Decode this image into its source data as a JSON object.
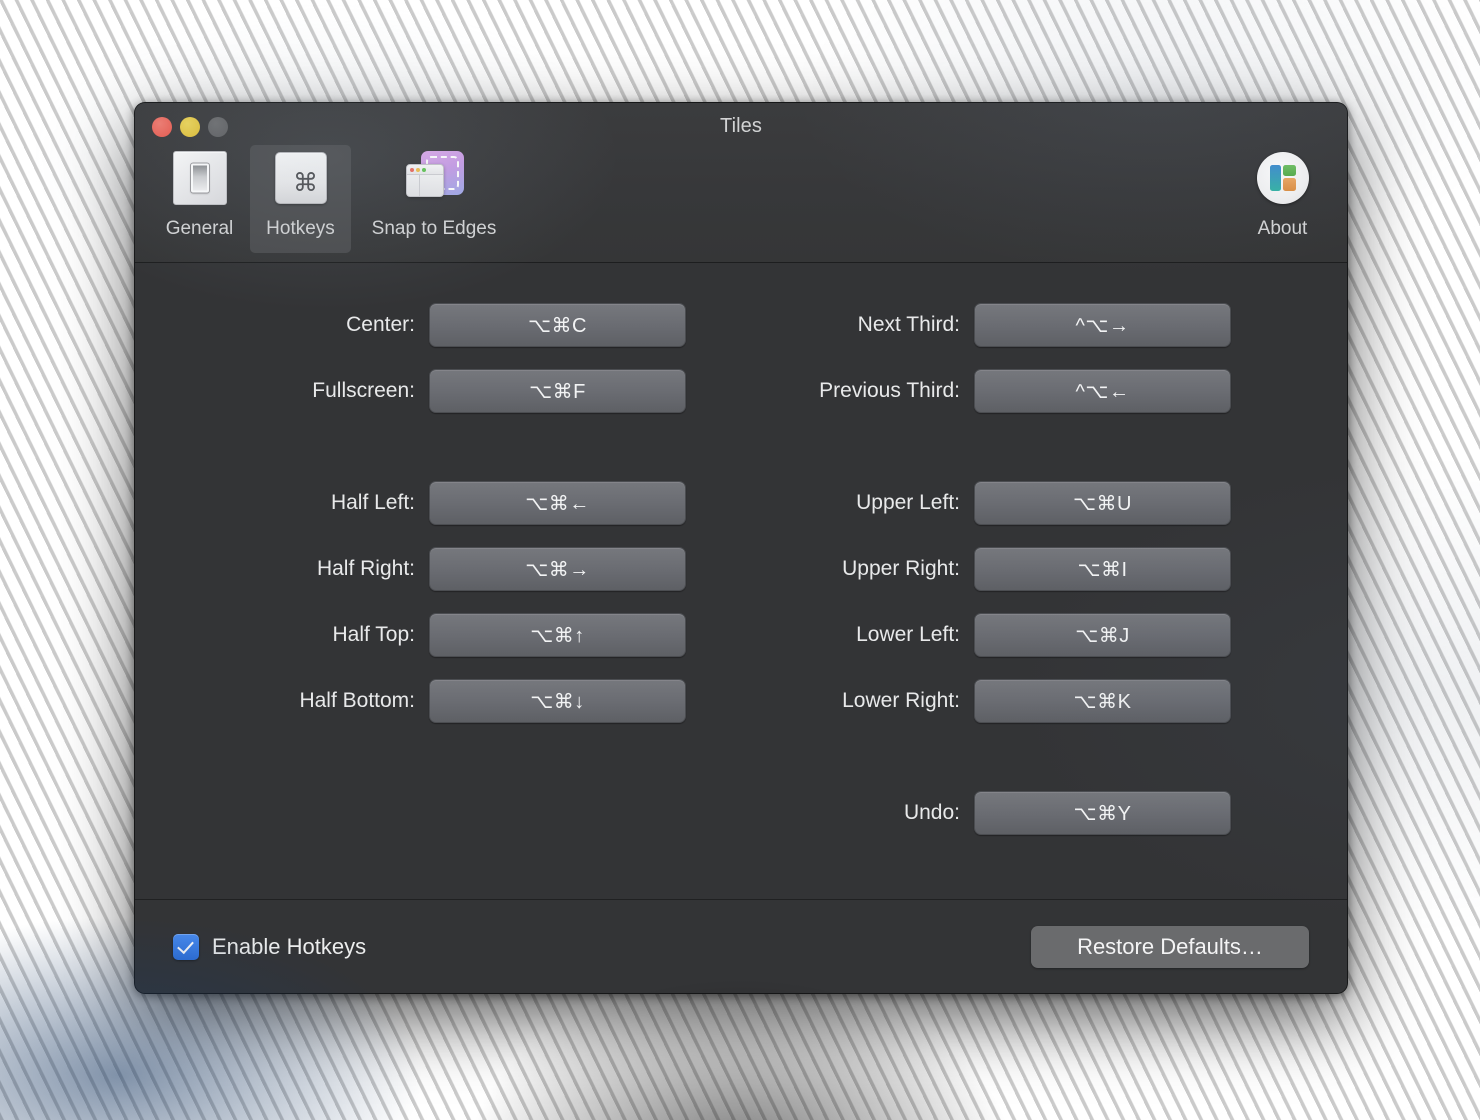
{
  "window": {
    "title": "Tiles",
    "traffic_lights": [
      {
        "name": "close",
        "color": "#ec6a5e"
      },
      {
        "name": "minimize",
        "color": "#e0bf34"
      },
      {
        "name": "zoom",
        "color": "#5d5e60"
      }
    ]
  },
  "toolbar": {
    "items": [
      {
        "label": "General",
        "icon": "light-switch-icon",
        "selected": false
      },
      {
        "label": "Hotkeys",
        "icon": "command-keycap-icon",
        "selected": true
      },
      {
        "label": "Snap to Edges",
        "icon": "snap-to-edges-icon",
        "selected": false
      }
    ],
    "about": {
      "label": "About",
      "icon": "tiles-logo-icon"
    }
  },
  "hotkeys": {
    "left_column": [
      {
        "label": "Center:",
        "shortcut": "⌥⌘C"
      },
      {
        "label": "Fullscreen:",
        "shortcut": "⌥⌘F"
      },
      {
        "label": "Half Left:",
        "shortcut": "⌥⌘←"
      },
      {
        "label": "Half Right:",
        "shortcut": "⌥⌘→"
      },
      {
        "label": "Half Top:",
        "shortcut": "⌥⌘↑"
      },
      {
        "label": "Half Bottom:",
        "shortcut": "⌥⌘↓"
      }
    ],
    "right_column": [
      {
        "label": "Next Third:",
        "shortcut": "^⌥→"
      },
      {
        "label": "Previous Third:",
        "shortcut": "^⌥←"
      },
      {
        "label": "Upper Left:",
        "shortcut": "⌥⌘U"
      },
      {
        "label": "Upper Right:",
        "shortcut": "⌥⌘I"
      },
      {
        "label": "Lower Left:",
        "shortcut": "⌥⌘J"
      },
      {
        "label": "Lower Right:",
        "shortcut": "⌥⌘K"
      },
      {
        "label": "Undo:",
        "shortcut": "⌥⌘Y"
      }
    ]
  },
  "footer": {
    "enable_hotkeys_label": "Enable Hotkeys",
    "enable_hotkeys_checked": true,
    "restore_defaults_label": "Restore Defaults…"
  },
  "colors": {
    "window_background": "#333436",
    "toolbar_background": "#37383a",
    "button_face": "#6b6d73",
    "checkbox_accent": "#3b7dea",
    "text_primary": "#e8e9ea"
  }
}
